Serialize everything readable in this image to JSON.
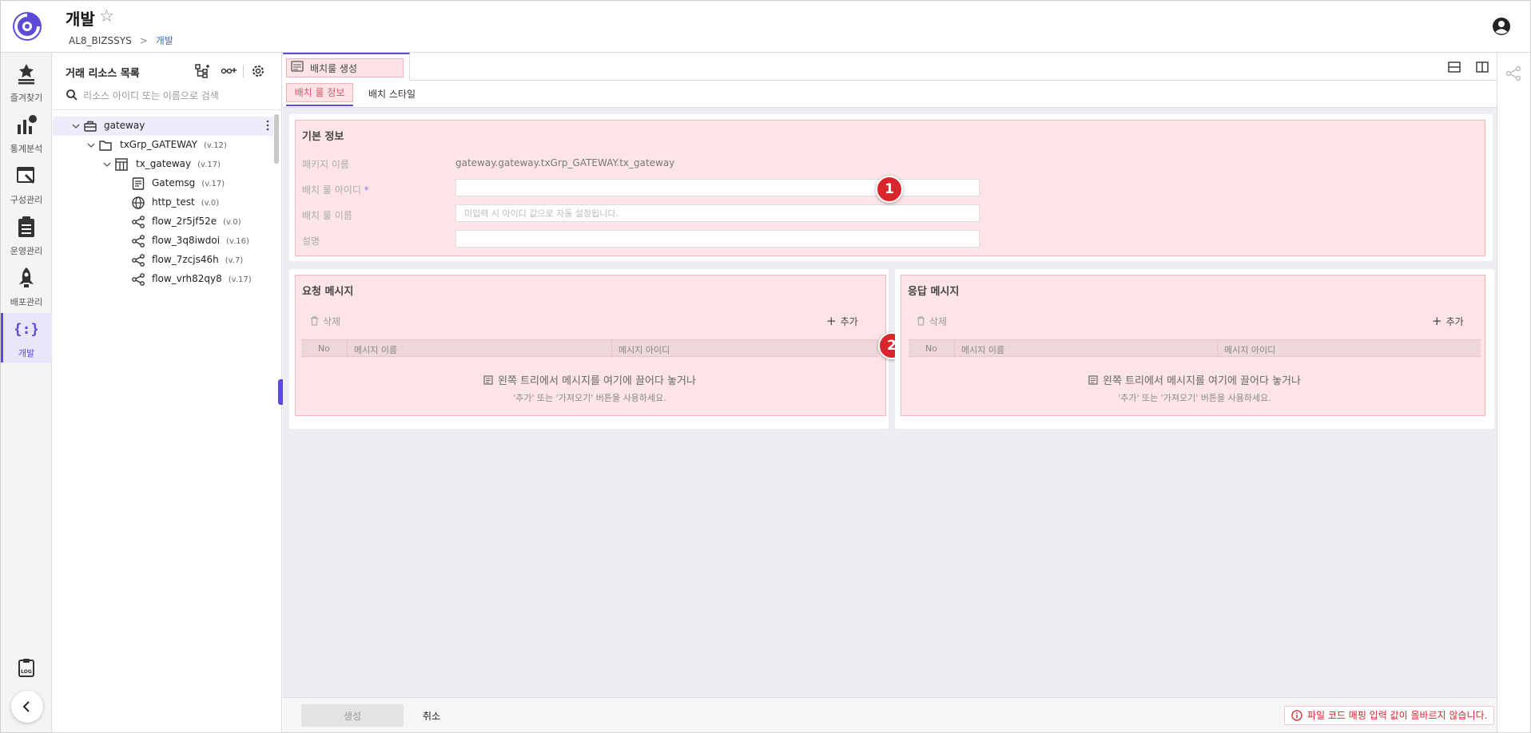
{
  "header": {
    "title": "개발",
    "breadcrumb": [
      "AL8_BIZSSYS",
      "개발"
    ],
    "breadcrumb_separator": ">"
  },
  "nav": {
    "items": [
      {
        "label": "즐겨찾기",
        "icon": "star-list-icon"
      },
      {
        "label": "통계분석",
        "icon": "bar-chart-icon"
      },
      {
        "label": "구성관리",
        "icon": "config-window-icon"
      },
      {
        "label": "운영관리",
        "icon": "clipboard-icon"
      },
      {
        "label": "배포관리",
        "icon": "rocket-icon"
      },
      {
        "label": "개발",
        "icon": "code-braces-icon",
        "active": true
      }
    ],
    "bottom": {
      "log_icon": "log-icon",
      "back_icon": "chevron-left-icon"
    },
    "accent": "#5b4bd8"
  },
  "tree": {
    "title": "거래 리소스 목록",
    "search_placeholder": "리소스 아이디 또는 이름으로 검색",
    "nodes": [
      {
        "name": "gateway",
        "version": "",
        "icon": "toolbox-icon",
        "depth": 0,
        "expanded": true,
        "selected": true
      },
      {
        "name": "txGrp_GATEWAY",
        "version": "(v.12)",
        "icon": "folder-icon",
        "depth": 1,
        "expanded": true
      },
      {
        "name": "tx_gateway",
        "version": "(v.17)",
        "icon": "table-icon",
        "depth": 2,
        "expanded": true
      },
      {
        "name": "Gatemsg",
        "version": "(v.17)",
        "icon": "message-icon",
        "depth": 3
      },
      {
        "name": "http_test",
        "version": "(v.0)",
        "icon": "globe-icon",
        "depth": 3
      },
      {
        "name": "flow_2r5jf52e",
        "version": "(v.0)",
        "icon": "flow-icon",
        "depth": 3
      },
      {
        "name": "flow_3q8iwdoi",
        "version": "(v.16)",
        "icon": "flow-icon",
        "depth": 3
      },
      {
        "name": "flow_7zcjs46h",
        "version": "(v.7)",
        "icon": "flow-icon",
        "depth": 3
      },
      {
        "name": "flow_vrh82qy8",
        "version": "(v.17)",
        "icon": "flow-icon",
        "depth": 3
      }
    ]
  },
  "doc_tab": {
    "label": "배치룰 생성"
  },
  "sub_tabs": [
    "배치 룰 정보",
    "배치 스타일"
  ],
  "basic_info": {
    "title": "기본 정보",
    "package_label": "패키지 이름",
    "package_value": "gateway.gateway.txGrp_GATEWAY.tx_gateway",
    "rule_id_label": "배치 룰 아이디",
    "required_mark": "*",
    "rule_id_value": "",
    "rule_name_label": "배치 룰 이름",
    "rule_name_placeholder": "미입력 시 아이디 값으로 자동 설정됩니다.",
    "desc_label": "설명",
    "desc_value": ""
  },
  "request": {
    "title": "요청 메시지",
    "delete_label": "삭제",
    "add_label": "추가",
    "columns": [
      "No",
      "메시지 이름",
      "메시지 아이디"
    ],
    "empty_line1": "왼쪽 트리에서 메시지를 여기에 끌어다 놓거나",
    "empty_line2": "'추가' 또는 '가져오기' 버튼을 사용하세요."
  },
  "response": {
    "title": "응답 메시지",
    "delete_label": "삭제",
    "add_label": "추가",
    "columns": [
      "No",
      "메시지 이름",
      "메시지 아이디"
    ],
    "empty_line1": "왼쪽 트리에서 메시지를 여기에 끌어다 놓거나",
    "empty_line2": "'추가' 또는 '가져오기' 버튼을 사용하세요."
  },
  "badges": [
    "1",
    "2"
  ],
  "footer": {
    "create_label": "생성",
    "cancel_label": "취소",
    "error_message": "파일 코드 매핑 입력 값이 올바르지 않습니다."
  },
  "colors": {
    "highlight_fill": "#fde5e7",
    "highlight_border": "#f2b7bd",
    "error": "#d8262c"
  }
}
